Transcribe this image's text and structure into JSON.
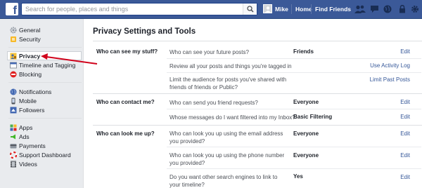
{
  "topbar": {
    "logo": "f",
    "search_placeholder": "Search for people, places and things",
    "user_name": "Mike",
    "home_label": "Home",
    "find_friends_label": "Find Friends",
    "brand_color": "#3b5998"
  },
  "sidebar": {
    "items": [
      {
        "label": "General",
        "icon": "gear-icon"
      },
      {
        "label": "Security",
        "icon": "shield-icon"
      },
      {
        "label": "Privacy",
        "icon": "privacy-lock-icon"
      },
      {
        "label": "Timeline and Tagging",
        "icon": "timeline-icon"
      },
      {
        "label": "Blocking",
        "icon": "block-icon"
      },
      {
        "label": "Notifications",
        "icon": "globe-icon"
      },
      {
        "label": "Mobile",
        "icon": "mobile-icon"
      },
      {
        "label": "Followers",
        "icon": "followers-icon"
      },
      {
        "label": "Apps",
        "icon": "apps-icon"
      },
      {
        "label": "Ads",
        "icon": "ads-icon"
      },
      {
        "label": "Payments",
        "icon": "payments-icon"
      },
      {
        "label": "Support Dashboard",
        "icon": "support-icon"
      },
      {
        "label": "Videos",
        "icon": "videos-icon"
      }
    ],
    "active": "Privacy"
  },
  "main": {
    "title": "Privacy Settings and Tools",
    "sections": [
      {
        "label": "Who can see my stuff?",
        "rows": [
          {
            "question": "Who can see your future posts?",
            "value": "Friends",
            "action": "Edit"
          },
          {
            "question": "Review all your posts and things you're tagged in",
            "value": "",
            "action": "Use Activity Log"
          },
          {
            "question": "Limit the audience for posts you've shared with friends of friends or Public?",
            "value": "",
            "action": "Limit Past Posts"
          }
        ]
      },
      {
        "label": "Who can contact me?",
        "rows": [
          {
            "question": "Who can send you friend requests?",
            "value": "Everyone",
            "action": "Edit"
          },
          {
            "question": "Whose messages do I want filtered into my Inbox?",
            "value": "Basic Filtering",
            "action": "Edit"
          }
        ]
      },
      {
        "label": "Who can look me up?",
        "rows": [
          {
            "question": "Who can look you up using the email address you provided?",
            "value": "Everyone",
            "action": "Edit"
          },
          {
            "question": "Who can look you up using the phone number you provided?",
            "value": "Everyone",
            "action": "Edit"
          },
          {
            "question": "Do you want other search engines to link to your timeline?",
            "value": "Yes",
            "action": "Edit"
          }
        ]
      }
    ]
  },
  "annotation": {
    "arrow_color": "#d0021b"
  }
}
